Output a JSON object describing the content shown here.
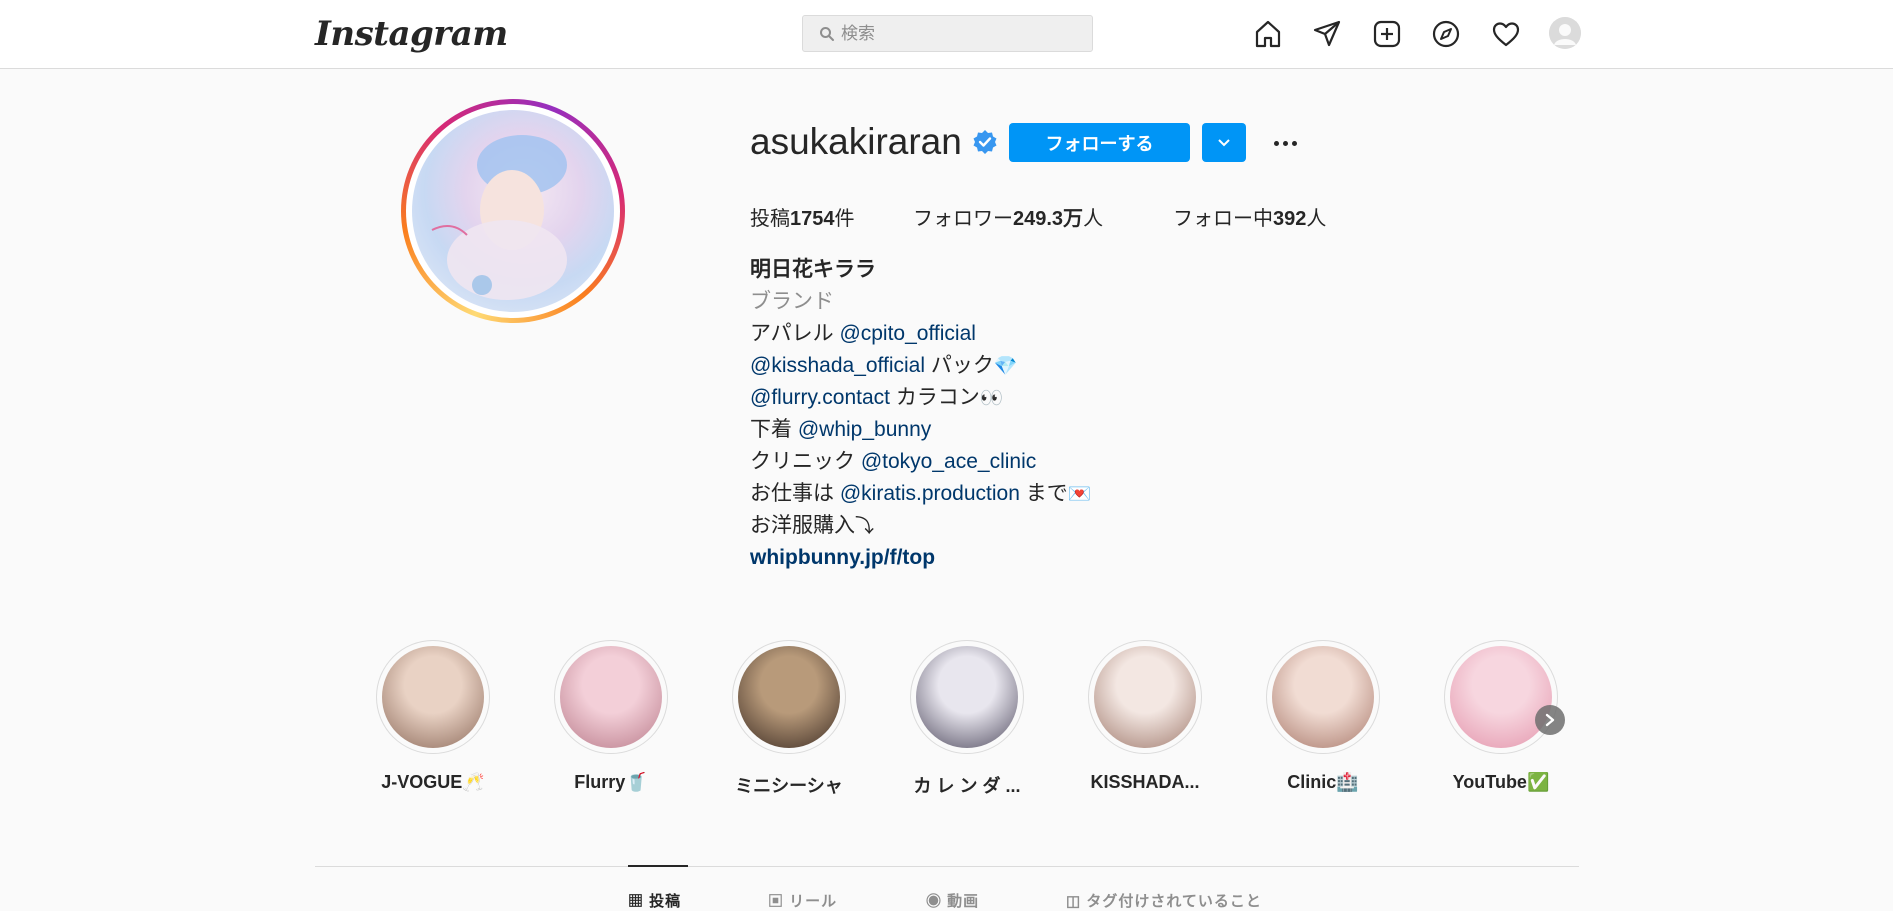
{
  "nav": {
    "logo": "Instagram",
    "search_placeholder": "検索",
    "icons": [
      "home-icon",
      "direct-message-icon",
      "new-post-icon",
      "explore-icon",
      "activity-icon",
      "profile-avatar"
    ]
  },
  "profile": {
    "username": "asukakiraran",
    "verified": true,
    "follow_label": "フォローする",
    "stats": {
      "posts_prefix": "投稿",
      "posts_count": "1754",
      "posts_suffix": "件",
      "followers_prefix": "フォロワー",
      "followers_count": "249.3万",
      "followers_suffix": "人",
      "following_prefix": "フォロー中",
      "following_count": "392",
      "following_suffix": "人"
    },
    "bio": {
      "name": "明日花キララ",
      "category": "ブランド",
      "line1_text": "アパレル",
      "line1_mention": "@cpito_official",
      "line2_mention": "@kisshada_official",
      "line2_text": "パック",
      "line2_emoji": "💎",
      "line3_mention": "@flurry.contact",
      "line3_text": "カラコン",
      "line3_emoji": "👀",
      "line4_text": "下着",
      "line4_mention": "@whip_bunny",
      "line5_text": "クリニック",
      "line5_mention": "@tokyo_ace_clinic",
      "line6_text_before": "お仕事は",
      "line6_mention": "@kiratis.production",
      "line6_text_after": "まで",
      "line6_emoji": "💌",
      "line7_text": "お洋服購入",
      "line7_emoji": "⤵",
      "url": "whipbunny.jp/f/top"
    }
  },
  "highlights": [
    {
      "label": "J-VOGUE🥂",
      "color1": "#e9d2c4",
      "color2": "#8c6a5a"
    },
    {
      "label": "Flurry🥤",
      "color1": "#f3cfd8",
      "color2": "#b97b8a"
    },
    {
      "label": "ミニシーシャ",
      "color1": "#b89a7a",
      "color2": "#3a2a22"
    },
    {
      "label": "カ レ ン ダ ...",
      "color1": "#e8e6ee",
      "color2": "#4f4a5e"
    },
    {
      "label": "KISSHADA...",
      "color1": "#f3e7e2",
      "color2": "#a07a6d"
    },
    {
      "label": "Clinic🏥",
      "color1": "#f1dcd3",
      "color2": "#a8786a"
    },
    {
      "label": "YouTube✅",
      "color1": "#f7d6df",
      "color2": "#e394ab"
    }
  ],
  "tabs": [
    {
      "label": "投稿",
      "active": true
    },
    {
      "label": "リール",
      "active": false
    },
    {
      "label": "動画",
      "active": false
    },
    {
      "label": "タグ付けされていること",
      "active": false
    }
  ],
  "colors": {
    "accent": "#0095f6",
    "link": "#00376b",
    "verified": "#3897f0"
  }
}
